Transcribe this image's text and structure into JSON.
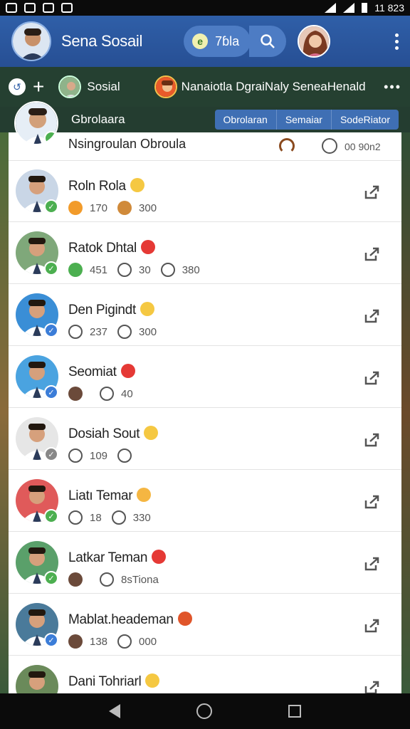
{
  "status_bar": {
    "time": "11 823"
  },
  "app_bar": {
    "title": "Sena Sosail",
    "pill_value": "7ɓla",
    "pill_dot": "e"
  },
  "story_bar": {
    "item1": "Sosial",
    "item2": "Nanaiotla DgraiNaly SeneaHenald"
  },
  "group_bar": {
    "title": "Gbrolaara",
    "chips": [
      "Obrolaran",
      "Semaiar",
      "SodeRiator"
    ]
  },
  "first_row": {
    "name": "Nsingroulan Obroula",
    "value": "00 90n2"
  },
  "rows": [
    {
      "name": "Roln Rola",
      "emoji_color": "#f5c842",
      "badge_color": "#4caf50",
      "av_bg": "#c9d6e6",
      "stats": [
        "170",
        "300"
      ],
      "stat_colors": [
        "#f29b2a",
        "#d08a3a"
      ]
    },
    {
      "name": "Ratok Dhtal",
      "emoji_color": "#e53935",
      "badge_color": "#4caf50",
      "av_bg": "#7fa87a",
      "stats": [
        "451",
        "30",
        "380"
      ],
      "stat_colors": [
        "#4caf50",
        "outline",
        "outline"
      ]
    },
    {
      "name": "Den Pigindt",
      "emoji_color": "#f5c842",
      "badge_color": "#3b7dd8",
      "av_bg": "#3a8ed6",
      "stats": [
        "237",
        "300"
      ],
      "stat_colors": [
        "outline",
        "outline"
      ]
    },
    {
      "name": "Seomiat",
      "emoji_color": "#e53935",
      "badge_color": "#3b7dd8",
      "av_bg": "#4aa3e0",
      "stats": [
        "",
        "40"
      ],
      "stat_colors": [
        "#6b4a3a",
        "outline"
      ]
    },
    {
      "name": "Dosiah Sout",
      "emoji_color": "#f5c842",
      "badge_color": "#888",
      "av_bg": "#e6e6e6",
      "stats": [
        "109",
        ""
      ],
      "stat_colors": [
        "outline",
        "outline"
      ]
    },
    {
      "name": "Liatı Temar",
      "emoji_color": "#f5b642",
      "badge_color": "#4caf50",
      "av_bg": "#e05a5a",
      "stats": [
        "18",
        "330"
      ],
      "stat_colors": [
        "outline",
        "outline"
      ]
    },
    {
      "name": "Latkar Teman",
      "emoji_color": "#e53935",
      "badge_color": "#4caf50",
      "av_bg": "#5aa06a",
      "stats": [
        "",
        "8sTiona"
      ],
      "stat_colors": [
        "#6b4a3a",
        "outline"
      ]
    },
    {
      "name": "Mablat.heademan",
      "emoji_color": "#e0552a",
      "badge_color": "#3b7dd8",
      "av_bg": "#4a7a9a",
      "stats": [
        "138",
        "000"
      ],
      "stat_colors": [
        "#6b4a3a",
        "outline"
      ]
    },
    {
      "name": "Dani Tohriarl",
      "emoji_color": "#f5c842",
      "badge_color": "#4caf50",
      "av_bg": "#6a8a5a",
      "stats": [
        "",
        ""
      ],
      "stat_colors": [
        "#6b4a3a",
        "outline"
      ]
    }
  ]
}
